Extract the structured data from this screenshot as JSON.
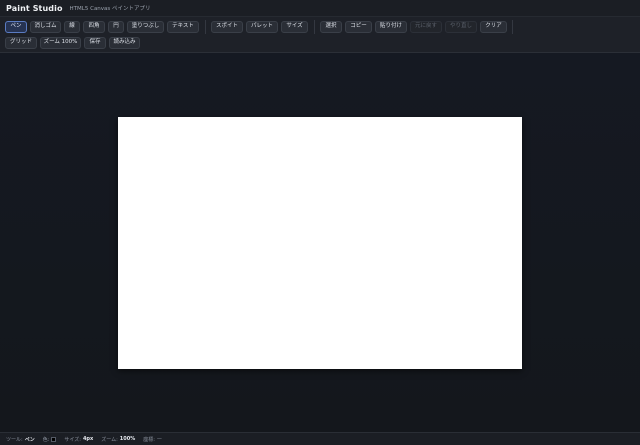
{
  "app": {
    "title": "Paint Studio",
    "subtitle": "HTML5 Canvas ペイントアプリ"
  },
  "toolbar": {
    "row1": [
      {
        "name": "pen-button",
        "label": "ペン",
        "state": "active"
      },
      {
        "name": "eraser-button",
        "label": "消しゴム",
        "state": "normal"
      },
      {
        "name": "line-button",
        "label": "線",
        "state": "normal"
      },
      {
        "name": "rectangle-button",
        "label": "四角",
        "state": "normal"
      },
      {
        "name": "circle-button",
        "label": "円",
        "state": "normal"
      },
      {
        "name": "fill-button",
        "label": "塗りつぶし",
        "state": "normal"
      },
      {
        "name": "text-button",
        "label": "テキスト",
        "state": "normal"
      },
      {
        "name": "eyedropper-button",
        "label": "スポイト",
        "state": "normal"
      },
      {
        "name": "palette-button",
        "label": "パレット",
        "state": "normal"
      },
      {
        "name": "size-button",
        "label": "サイズ",
        "state": "normal"
      },
      {
        "name": "select-button",
        "label": "選択",
        "state": "normal"
      },
      {
        "name": "copy-button",
        "label": "コピー",
        "state": "normal"
      },
      {
        "name": "paste-button",
        "label": "貼り付け",
        "state": "normal"
      },
      {
        "name": "undo-button",
        "label": "元に戻す",
        "state": "disabled"
      },
      {
        "name": "redo-button",
        "label": "やり直し",
        "state": "disabled"
      },
      {
        "name": "clear-button",
        "label": "クリア",
        "state": "normal"
      }
    ],
    "row2": [
      {
        "name": "grid-button",
        "label": "グリッド",
        "state": "normal"
      },
      {
        "name": "zoom-button",
        "label": "ズーム 100%",
        "state": "normal"
      },
      {
        "name": "save-button",
        "label": "保存",
        "state": "normal"
      },
      {
        "name": "load-button",
        "label": "読み込み",
        "state": "normal"
      }
    ]
  },
  "canvas": {
    "background": "#ffffff"
  },
  "status": {
    "tool_label": "ツール:",
    "tool_value": "ペン",
    "color_label": "色:",
    "color_value": "#000000",
    "size_label": "サイズ:",
    "size_value": "4px",
    "zoom_label": "ズーム:",
    "zoom_value": "100%",
    "coord_label": "座標:",
    "coord_value": "—"
  },
  "colors": {
    "accent": "#5a7bc2",
    "active_bg": "#263352",
    "workspace": "#151922",
    "button_bg": "#2a2e36"
  }
}
